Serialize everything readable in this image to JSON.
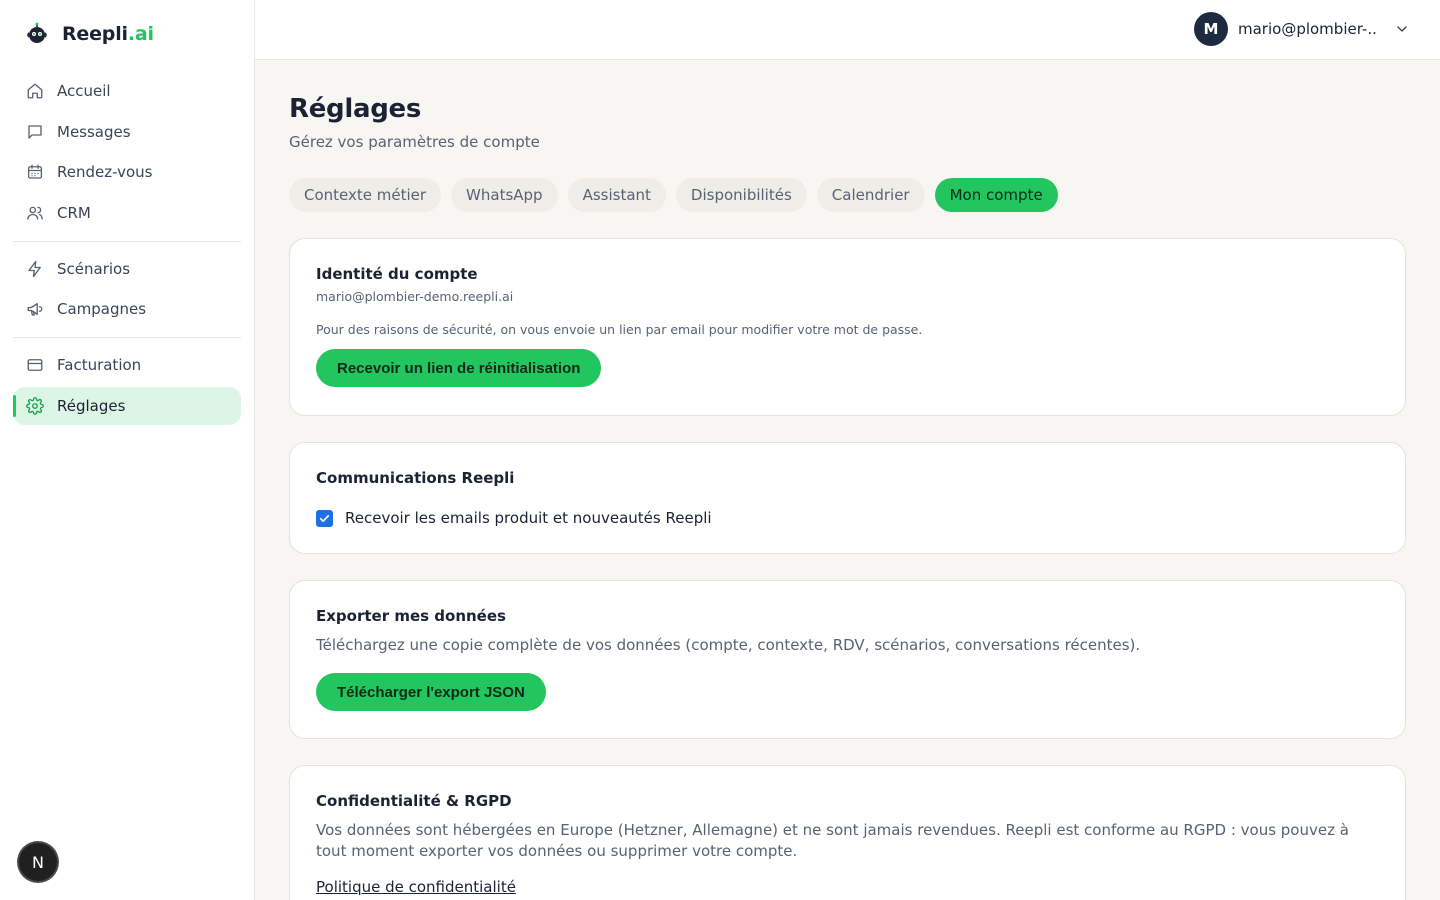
{
  "brand": {
    "name_main": "Reepli",
    "name_accent": ".ai"
  },
  "sidebar": {
    "items": [
      {
        "label": "Accueil",
        "icon": "home-icon"
      },
      {
        "label": "Messages",
        "icon": "message-icon"
      },
      {
        "label": "Rendez-vous",
        "icon": "calendar-icon"
      },
      {
        "label": "CRM",
        "icon": "users-icon"
      },
      {
        "label": "Scénarios",
        "icon": "bolt-icon"
      },
      {
        "label": "Campagnes",
        "icon": "megaphone-icon"
      },
      {
        "label": "Facturation",
        "icon": "credit-card-icon"
      },
      {
        "label": "Réglages",
        "icon": "gear-icon",
        "active": true
      }
    ]
  },
  "badge": {
    "letter": "N"
  },
  "header": {
    "avatar_initial": "M",
    "user_email": "mario@plombier-..."
  },
  "page": {
    "title": "Réglages",
    "subtitle": "Gérez vos paramètres de compte"
  },
  "tabs": [
    {
      "label": "Contexte métier"
    },
    {
      "label": "WhatsApp"
    },
    {
      "label": "Assistant"
    },
    {
      "label": "Disponibilités"
    },
    {
      "label": "Calendrier"
    },
    {
      "label": "Mon compte",
      "active": true
    }
  ],
  "identity": {
    "title": "Identité du compte",
    "email": "mario@plombier-demo.reepli.ai",
    "note": "Pour des raisons de sécurité, on vous envoie un lien par email pour modifier votre mot de passe.",
    "button": "Recevoir un lien de réinitialisation"
  },
  "communications": {
    "title": "Communications Reepli",
    "checkbox_label": "Recevoir les emails produit et nouveautés Reepli",
    "checked": true
  },
  "export": {
    "title": "Exporter mes données",
    "description": "Téléchargez une copie complète de vos données (compte, contexte, RDV, scénarios, conversations récentes).",
    "button": "Télécharger l'export JSON"
  },
  "privacy": {
    "title": "Confidentialité & RGPD",
    "description": "Vos données sont hébergées en Europe (Hetzner, Allemagne) et ne sont jamais revendues. Reepli est conforme au RGPD : vous pouvez à tout moment exporter vos données ou supprimer votre compte.",
    "link": "Politique de confidentialité"
  },
  "colors": {
    "accent": "#22c55e",
    "accent_light": "#dcf5e5",
    "checkbox": "#1d6fe5",
    "background": "#f8f6f2"
  }
}
